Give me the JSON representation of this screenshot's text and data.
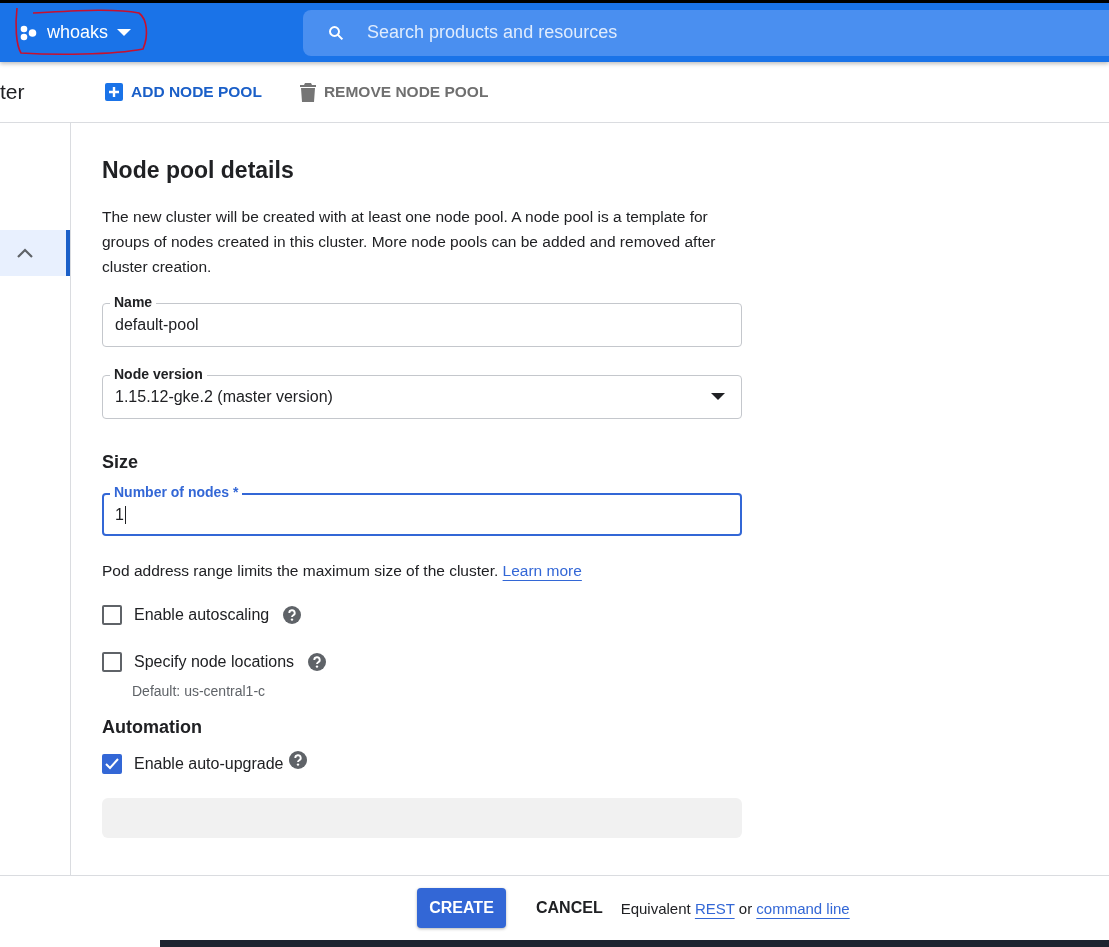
{
  "header": {
    "project": "whoaks",
    "search": {
      "placeholder": "Search products and resources"
    }
  },
  "toolbar": {
    "title": "ter",
    "actions": [
      {
        "label": "ADD NODE POOL",
        "kind": "add",
        "disabled": false
      },
      {
        "label": "REMOVE NODE POOL",
        "kind": "remove",
        "disabled": true
      }
    ]
  },
  "sidebar": {
    "items": [
      {
        "selected": true,
        "expanded": true
      }
    ]
  },
  "section": {
    "title": "Node pool details",
    "description": "The new cluster will be created with at least one node pool. A node pool is a template for groups of nodes created in this cluster. More node pools can be added and removed after cluster creation."
  },
  "fields": [
    {
      "label": "Name",
      "value": "default-pool",
      "kind": "text"
    },
    {
      "label": "Node version",
      "value": "1.15.12-gke.2 (master version)",
      "kind": "select"
    }
  ],
  "size": {
    "title": "Size",
    "field": {
      "label": "Number of nodes *",
      "value": "1",
      "focused": true
    },
    "note": "Pod address range limits the maximum size of the cluster.",
    "note_link": "Learn more",
    "options": [
      {
        "label": "Enable autoscaling",
        "checked": false,
        "help": true
      },
      {
        "label": "Specify node locations",
        "checked": false,
        "help": true,
        "hint": "Default: us-central1-c"
      }
    ]
  },
  "automation": {
    "title": "Automation",
    "options": [
      {
        "label": "Enable auto-upgrade",
        "checked": true,
        "help": true
      }
    ]
  },
  "footer": {
    "create": "CREATE",
    "cancel": "CANCEL",
    "equivalent": "Equivalent",
    "rest": "REST",
    "or": "or",
    "command_line": "command line"
  }
}
